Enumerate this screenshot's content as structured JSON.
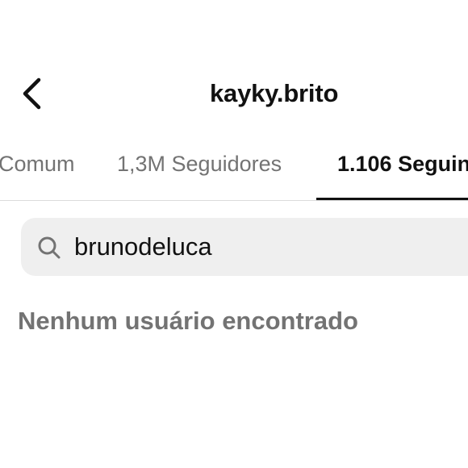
{
  "header": {
    "back_icon": "chevron-left-icon",
    "title": "kayky.brito"
  },
  "tabs": [
    {
      "label": "Comum",
      "active": false
    },
    {
      "label": "1,3M Seguidores",
      "active": false
    },
    {
      "label": "1.106 Seguin",
      "active": true
    }
  ],
  "search": {
    "icon": "search-icon",
    "value": "brunodeluca"
  },
  "results": {
    "empty_message": "Nenhum usuário encontrado"
  }
}
